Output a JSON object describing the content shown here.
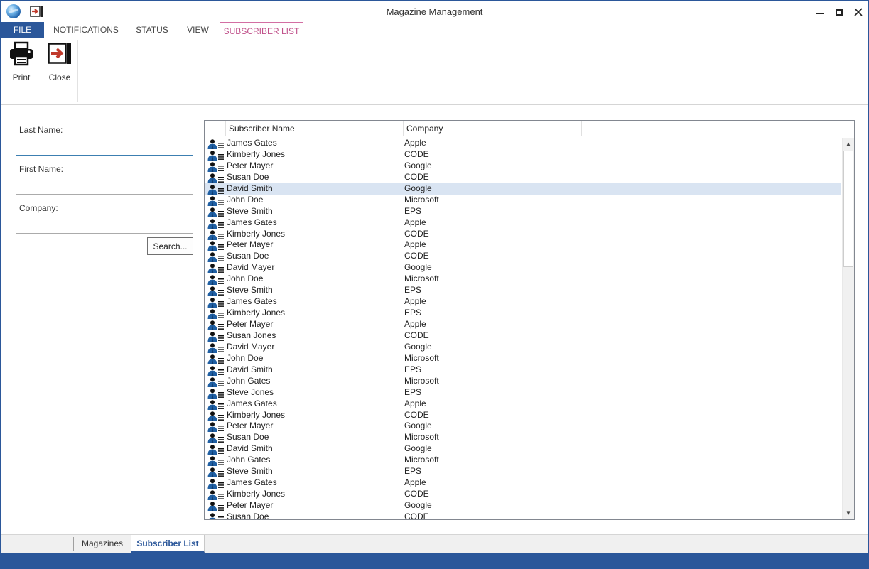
{
  "window": {
    "title": "Magazine Management"
  },
  "ribbon": {
    "tabs": [
      {
        "label": "FILE"
      },
      {
        "label": "NOTIFICATIONS"
      },
      {
        "label": "STATUS"
      },
      {
        "label": "VIEW"
      },
      {
        "label": "SUBSCRIBER LIST"
      }
    ],
    "active_tab": "SUBSCRIBER LIST",
    "buttons": {
      "print": {
        "label": "Print",
        "icon": "printer-icon"
      },
      "close": {
        "label": "Close",
        "icon": "exit-icon"
      }
    }
  },
  "search": {
    "last_name_label": "Last Name:",
    "last_name_value": "",
    "first_name_label": "First Name:",
    "first_name_value": "",
    "company_label": "Company:",
    "company_value": "",
    "button_label": "Search..."
  },
  "list": {
    "columns": [
      "Subscriber Name",
      "Company"
    ],
    "selected_index": 4,
    "rows": [
      {
        "name": "James Gates",
        "company": "Apple"
      },
      {
        "name": "Kimberly Jones",
        "company": "CODE"
      },
      {
        "name": "Peter Mayer",
        "company": "Google"
      },
      {
        "name": "Susan Doe",
        "company": "CODE"
      },
      {
        "name": "David Smith",
        "company": "Google"
      },
      {
        "name": "John Doe",
        "company": "Microsoft"
      },
      {
        "name": "Steve Smith",
        "company": "EPS"
      },
      {
        "name": "James Gates",
        "company": "Apple"
      },
      {
        "name": "Kimberly Jones",
        "company": "CODE"
      },
      {
        "name": "Peter Mayer",
        "company": "Apple"
      },
      {
        "name": "Susan Doe",
        "company": "CODE"
      },
      {
        "name": "David Mayer",
        "company": "Google"
      },
      {
        "name": "John Doe",
        "company": "Microsoft"
      },
      {
        "name": "Steve Smith",
        "company": "EPS"
      },
      {
        "name": "James Gates",
        "company": "Apple"
      },
      {
        "name": "Kimberly Jones",
        "company": "EPS"
      },
      {
        "name": "Peter Mayer",
        "company": "Apple"
      },
      {
        "name": "Susan Jones",
        "company": "CODE"
      },
      {
        "name": "David Mayer",
        "company": "Google"
      },
      {
        "name": "John Doe",
        "company": "Microsoft"
      },
      {
        "name": "David Smith",
        "company": "EPS"
      },
      {
        "name": "John Gates",
        "company": "Microsoft"
      },
      {
        "name": "Steve Jones",
        "company": "EPS"
      },
      {
        "name": "James Gates",
        "company": "Apple"
      },
      {
        "name": "Kimberly Jones",
        "company": "CODE"
      },
      {
        "name": "Peter Mayer",
        "company": "Google"
      },
      {
        "name": "Susan Doe",
        "company": "Microsoft"
      },
      {
        "name": "David Smith",
        "company": "Google"
      },
      {
        "name": "John Gates",
        "company": "Microsoft"
      },
      {
        "name": "Steve Smith",
        "company": "EPS"
      },
      {
        "name": "James Gates",
        "company": "Apple"
      },
      {
        "name": "Kimberly Jones",
        "company": "CODE"
      },
      {
        "name": "Peter Mayer",
        "company": "Google"
      },
      {
        "name": "Susan Doe",
        "company": "CODE"
      }
    ]
  },
  "document_tabs": [
    {
      "label": "Magazines"
    },
    {
      "label": "Subscriber List"
    }
  ],
  "active_document_tab": "Subscriber List",
  "colors": {
    "accent": "#2b579a",
    "tab_highlight": "#c0508a",
    "selection": "#d9e4f2"
  }
}
